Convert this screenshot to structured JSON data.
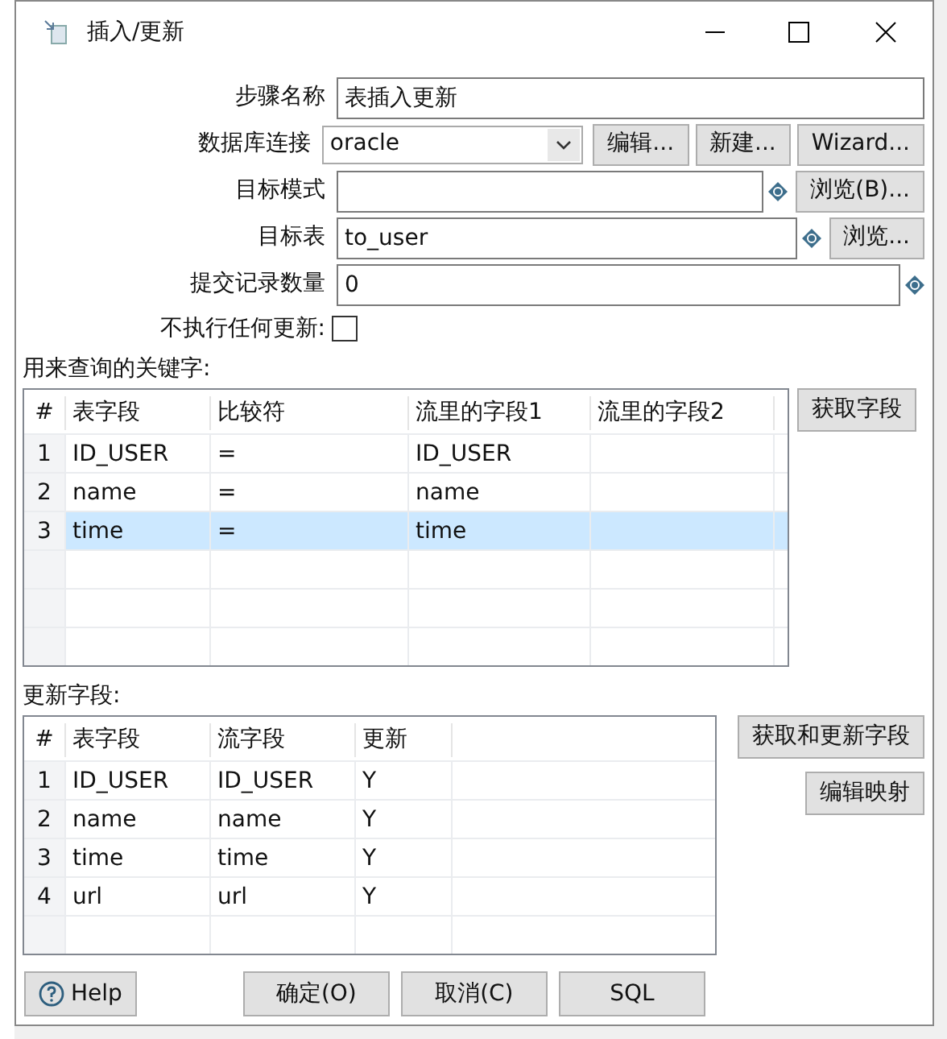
{
  "window": {
    "title": "插入/更新"
  },
  "form": [
    {
      "kind": "text",
      "label": "步骤名称",
      "value": "表插入更新",
      "variable": false
    },
    {
      "kind": "combo",
      "label": "数据库连接",
      "value": "oracle",
      "variable": false,
      "buttons": [
        "编辑...",
        "新建...",
        "Wizard..."
      ]
    },
    {
      "kind": "text",
      "label": "目标模式",
      "variable": true,
      "buttons": [
        "浏览(B)..."
      ]
    },
    {
      "kind": "text",
      "label": "目标表",
      "value": "to_user",
      "variable": true,
      "buttons": [
        "浏览..."
      ]
    },
    {
      "kind": "text",
      "label": "提交记录数量",
      "value": "0",
      "variable": true
    },
    {
      "kind": "checkbox",
      "label": "不执行任何更新:",
      "checked": false
    }
  ],
  "key_table": {
    "label": "用来查询的关键字:",
    "columns": [
      "#",
      "表字段",
      "比较符",
      "流里的字段1",
      "流里的字段2"
    ],
    "rows": [
      {
        "cells": [
          "1",
          "ID_USER",
          "=",
          "ID_USER",
          ""
        ],
        "selected": false
      },
      {
        "cells": [
          "2",
          "name",
          "=",
          "name",
          ""
        ],
        "selected": false
      },
      {
        "cells": [
          "3",
          "time",
          "=",
          "time",
          ""
        ],
        "selected": true
      }
    ],
    "buttons": [
      "获取字段"
    ]
  },
  "update_table": {
    "label": "更新字段:",
    "columns": [
      "#",
      "表字段",
      "流字段",
      "更新"
    ],
    "rows": [
      {
        "cells": [
          "1",
          "ID_USER",
          "ID_USER",
          "Y"
        ],
        "selected": false
      },
      {
        "cells": [
          "2",
          "name",
          "name",
          "Y"
        ],
        "selected": false
      },
      {
        "cells": [
          "3",
          "time",
          "time",
          "Y"
        ],
        "selected": false
      },
      {
        "cells": [
          "4",
          "url",
          "url",
          "Y"
        ],
        "selected": false
      }
    ],
    "buttons": [
      "获取和更新字段",
      "编辑映射"
    ]
  },
  "help_button": "Help",
  "footer_buttons": [
    "确定(O)",
    "取消(C)",
    "SQL"
  ]
}
